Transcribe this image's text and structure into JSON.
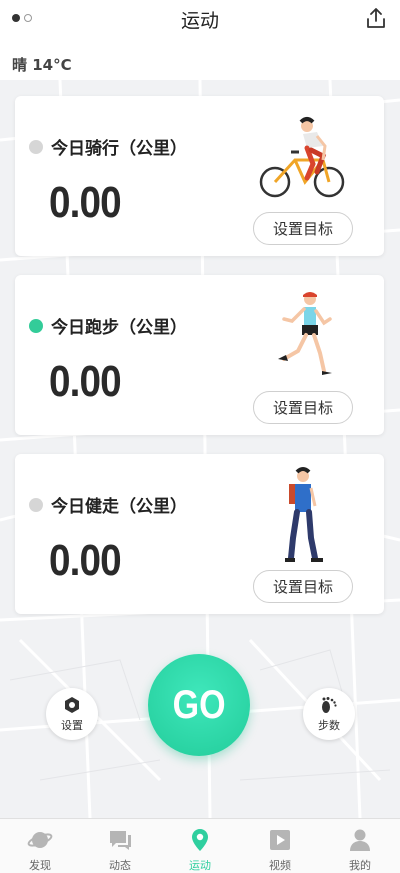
{
  "header": {
    "title": "运动",
    "page_indicator": {
      "count": 2,
      "active": 1
    }
  },
  "weather": "晴 14°C",
  "cards": [
    {
      "label": "今日骑行（公里）",
      "value": "0.00",
      "goal_button": "设置目标",
      "dot_color": "#d6d6d6",
      "illustration": "cyclist-illustration"
    },
    {
      "label": "今日跑步（公里）",
      "value": "0.00",
      "goal_button": "设置目标",
      "dot_color": "#33cc99",
      "illustration": "runner-illustration"
    },
    {
      "label": "今日健走（公里）",
      "value": "0.00",
      "goal_button": "设置目标",
      "dot_color": "#d6d6d6",
      "illustration": "walker-illustration"
    }
  ],
  "controls": {
    "settings_label": "设置",
    "go_label": "GO",
    "steps_label": "步数"
  },
  "tabbar": {
    "tabs": [
      {
        "label": "发现",
        "icon": "planet-icon"
      },
      {
        "label": "动态",
        "icon": "chat-icon"
      },
      {
        "label": "运动",
        "icon": "location-pin-icon",
        "active": true
      },
      {
        "label": "视频",
        "icon": "video-play-icon"
      },
      {
        "label": "我的",
        "icon": "person-icon"
      }
    ]
  },
  "colors": {
    "accent": "#2fcf9f"
  }
}
